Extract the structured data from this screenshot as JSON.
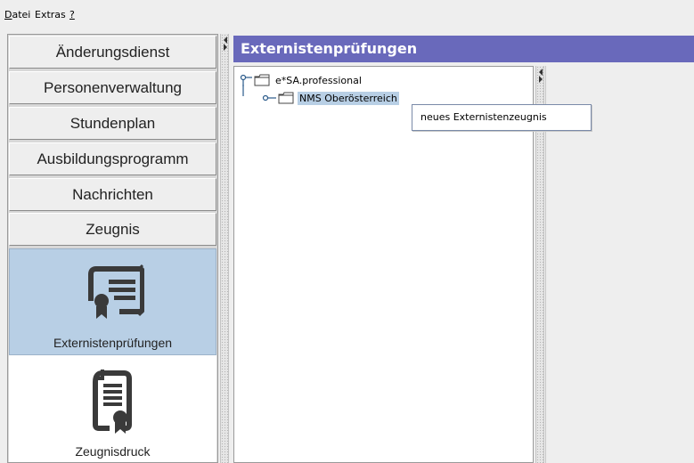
{
  "menubar": {
    "items": [
      {
        "mnemonic": "D",
        "rest": "atei"
      },
      {
        "mnemonic": "",
        "rest": "Extras"
      },
      {
        "mnemonic": "?",
        "rest": ""
      }
    ]
  },
  "sidebar": {
    "items": [
      {
        "label": "Änderungsdienst"
      },
      {
        "label": "Personenverwaltung"
      },
      {
        "label": "Stundenplan"
      },
      {
        "label": "Ausbildungsprogramm"
      },
      {
        "label": "Nachrichten"
      },
      {
        "label": "Zeugnis"
      }
    ],
    "tiles": [
      {
        "label": "Externistenprüfungen",
        "icon": "certificate-icon",
        "selected": true
      },
      {
        "label": "Zeugnisdruck",
        "icon": "document-award-icon",
        "selected": false
      }
    ]
  },
  "main": {
    "title": "Externistenprüfungen",
    "tree": [
      {
        "label": "e*SA.professional",
        "icon": "folder-icon"
      },
      {
        "label": "NMS Oberösterreich",
        "icon": "folder-icon",
        "selected": true
      }
    ]
  },
  "context_menu": {
    "items": [
      {
        "label": "neues Externistenzeugnis"
      }
    ]
  },
  "colors": {
    "header_bg": "#6969bb",
    "selection": "#b8cfe5",
    "icon_dark": "#3a3a3a"
  }
}
